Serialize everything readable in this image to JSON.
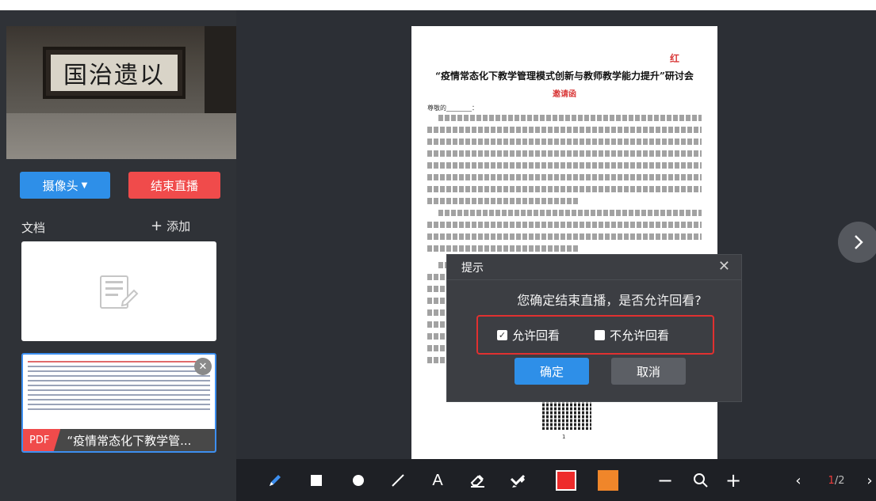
{
  "camera": {
    "plaque_text": "国治遗以"
  },
  "left_panel": {
    "camera_button": "摄像头",
    "end_live_button": "结束直播",
    "docs_label": "文档",
    "add_label": "添加"
  },
  "doc_list": [
    {
      "type": "",
      "name": ""
    },
    {
      "type": "PDF",
      "name": "“疫情常态化下教学管..."
    }
  ],
  "document_page": {
    "logo": "红",
    "title": "“疫情常态化下教学管理模式创新与教师教学能力提升”研讨会",
    "subtitle": "邀请函",
    "greeting": "尊敬的________：",
    "page_number": "1"
  },
  "dialog": {
    "title": "提示",
    "message": "您确定结束直播，是否允许回看?",
    "option_allow": "允许回看",
    "option_deny": "不允许回看",
    "allow_checked": true,
    "confirm": "确定",
    "cancel": "取消"
  },
  "toolbar": {
    "text_tool": "A",
    "zoom_out": "−",
    "zoom_in": "+",
    "prev": "‹",
    "next": "›",
    "current_page": "1",
    "total_pages": "/2",
    "colors": {
      "red": "#ee2b2b",
      "orange": "#f0862a"
    }
  },
  "colors": {
    "accent_blue": "#2e8fe8",
    "accent_red": "#f04b4b",
    "highlight_border": "#e03030"
  }
}
